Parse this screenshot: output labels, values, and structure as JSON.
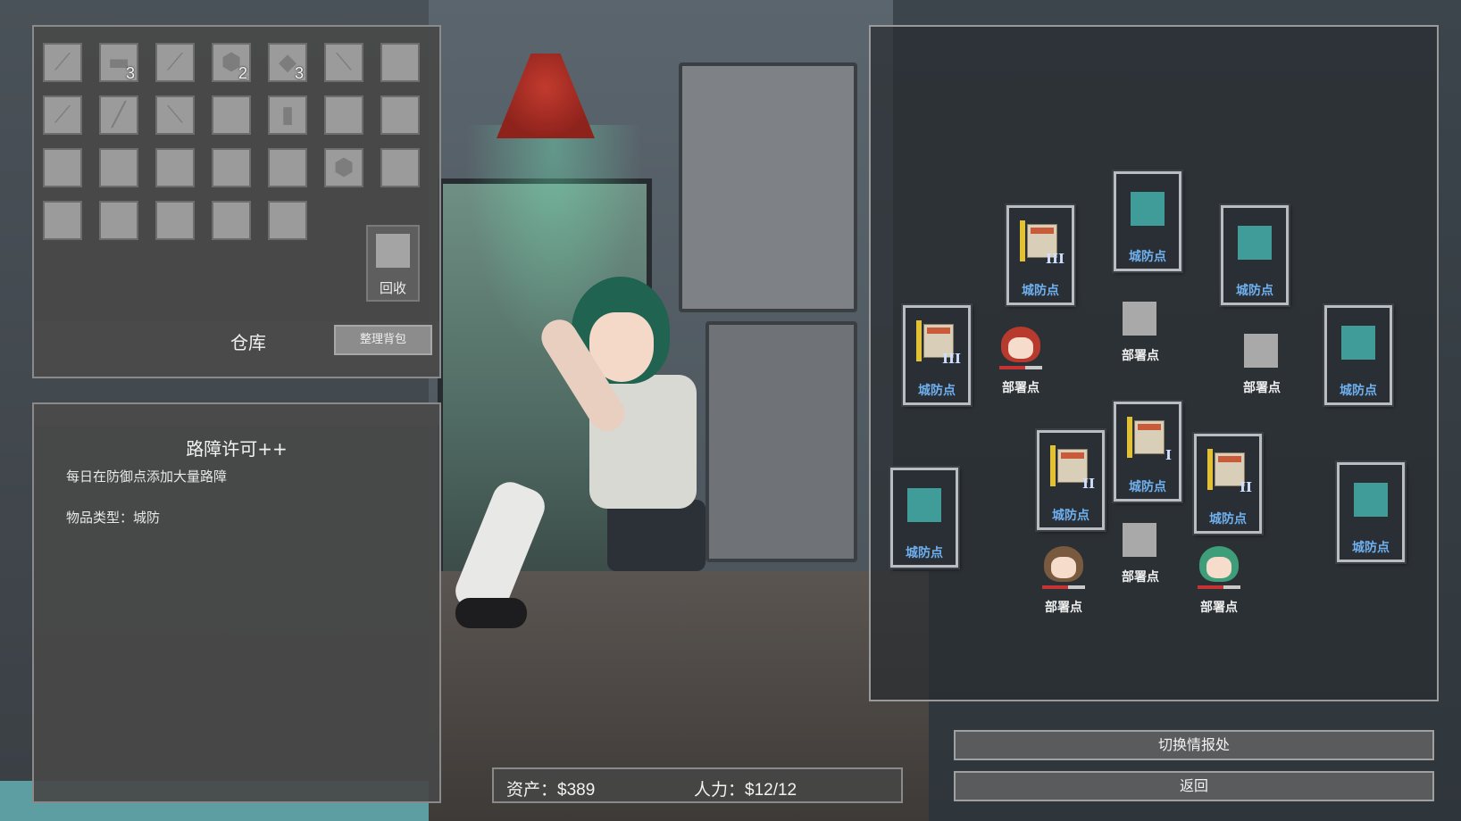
{
  "inventory": {
    "title": "仓库",
    "sort_button": "整理背包",
    "recycle_label": "回收",
    "slots": [
      {
        "icon": "pipe-icon",
        "count": ""
      },
      {
        "icon": "box-icon",
        "count": "3"
      },
      {
        "icon": "pipe-icon",
        "count": ""
      },
      {
        "icon": "rock-icon",
        "count": "2"
      },
      {
        "icon": "plate-icon",
        "count": "3"
      },
      {
        "icon": "tool-icon",
        "count": ""
      },
      {
        "icon": "",
        "count": ""
      },
      {
        "icon": "pipe-icon",
        "count": ""
      },
      {
        "icon": "rod-icon",
        "count": ""
      },
      {
        "icon": "tool-icon",
        "count": ""
      },
      {
        "icon": "",
        "count": ""
      },
      {
        "icon": "bottle-icon",
        "count": ""
      },
      {
        "icon": "",
        "count": ""
      },
      {
        "icon": "",
        "count": ""
      },
      {
        "icon": "",
        "count": ""
      },
      {
        "icon": "",
        "count": ""
      },
      {
        "icon": "",
        "count": ""
      },
      {
        "icon": "",
        "count": ""
      },
      {
        "icon": "",
        "count": ""
      },
      {
        "icon": "rock-icon",
        "count": ""
      },
      {
        "icon": "",
        "count": ""
      },
      {
        "icon": "",
        "count": ""
      },
      {
        "icon": "",
        "count": ""
      },
      {
        "icon": "",
        "count": ""
      },
      {
        "icon": "",
        "count": ""
      },
      {
        "icon": "",
        "count": ""
      }
    ]
  },
  "description": {
    "title": "路障许可++",
    "text": "每日在防御点添加大量路障",
    "item_type": "物品类型：城防"
  },
  "resources": {
    "assets": "资产：$389",
    "manpower": "人力：$12/12"
  },
  "map": {
    "defense_label": "城防点",
    "deploy_label": "部署点",
    "nodes": [
      {
        "kind": "license",
        "roman": "III"
      },
      {
        "kind": "teal",
        "roman": ""
      },
      {
        "kind": "teal",
        "roman": ""
      },
      {
        "kind": "license",
        "roman": "III"
      },
      {
        "kind": "teal",
        "roman": ""
      },
      {
        "kind": "license",
        "roman": "I"
      },
      {
        "kind": "license",
        "roman": "II"
      },
      {
        "kind": "license",
        "roman": "II"
      },
      {
        "kind": "teal",
        "roman": ""
      },
      {
        "kind": "teal",
        "roman": ""
      }
    ],
    "deploy_points": [
      {
        "unit": "red-hair-girl",
        "hair": "#b83a2e"
      },
      {
        "unit": "",
        "hair": ""
      },
      {
        "unit": "",
        "hair": ""
      },
      {
        "unit": "brown-hair-girl",
        "hair": "#7a5a3e"
      },
      {
        "unit": "",
        "hair": ""
      },
      {
        "unit": "green-hair-girl",
        "hair": "#3f9e7a"
      }
    ]
  },
  "actions": {
    "switch_label": "切换情报处",
    "back_label": "返回"
  },
  "colors": {
    "accent_label": "#6fb0ef",
    "defense_square": "#3f9c98"
  }
}
